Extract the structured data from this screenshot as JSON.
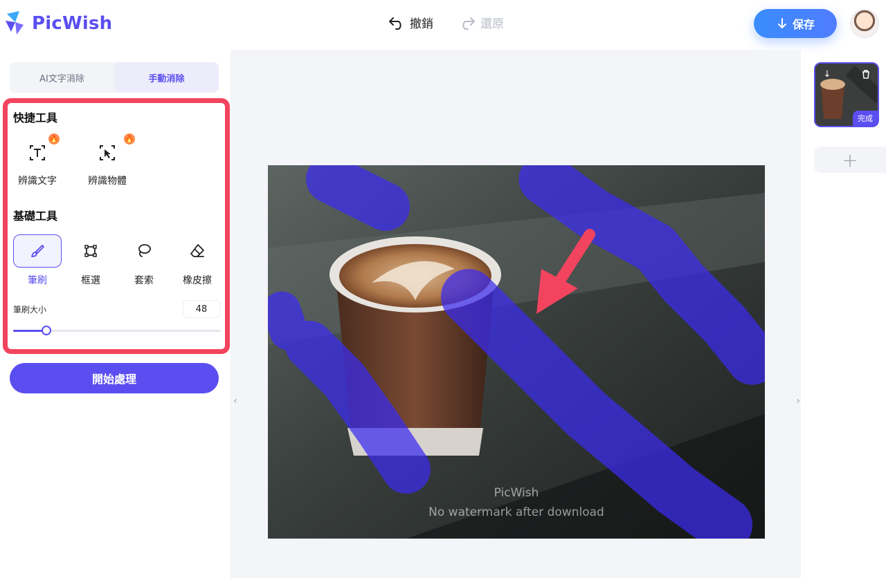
{
  "app": {
    "name": "PicWish"
  },
  "header": {
    "undo_label": "撤銷",
    "redo_label": "還原",
    "save_label": "保存"
  },
  "mode_tabs": [
    {
      "label": "AI文字消除",
      "active": false
    },
    {
      "label": "手動消除",
      "active": true
    }
  ],
  "quick_tools": {
    "title": "快捷工具",
    "items": [
      {
        "label": "辨識文字",
        "icon": "text-detect-icon",
        "hot": true
      },
      {
        "label": "辨識物體",
        "icon": "object-detect-icon",
        "hot": true
      }
    ]
  },
  "basic_tools": {
    "title": "基礎工具",
    "items": [
      {
        "label": "筆刷",
        "icon": "brush-icon",
        "active": true
      },
      {
        "label": "框選",
        "icon": "box-select-icon",
        "active": false
      },
      {
        "label": "套索",
        "icon": "lasso-icon",
        "active": false
      },
      {
        "label": "橡皮擦",
        "icon": "eraser-icon",
        "active": false
      }
    ]
  },
  "brush_size": {
    "label": "筆刷大小",
    "value": "48",
    "slider_fraction": 0.16
  },
  "start_button": {
    "label": "開始處理"
  },
  "canvas": {
    "watermark_title": "PicWish",
    "watermark_subtitle": "No watermark after download"
  },
  "thumbnail": {
    "status": "完成"
  },
  "colors": {
    "accent": "#5b4ef0",
    "highlight_border": "#f2445e",
    "save_gradient_start": "#3a8dfc",
    "brush_mask": "#3b2bf0"
  }
}
